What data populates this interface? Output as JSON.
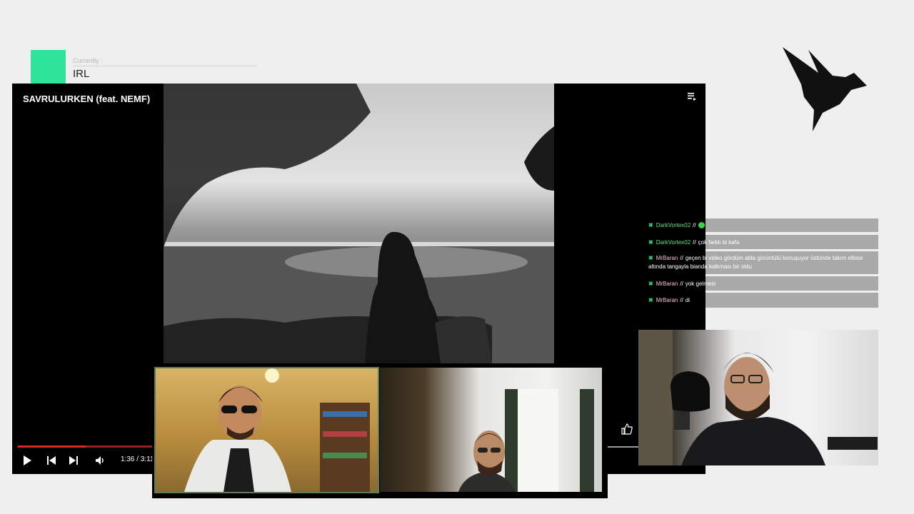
{
  "header": {
    "currently_label": "Currently :",
    "currently_value": "IRL"
  },
  "player": {
    "title": "SAVRULURKEN (feat. NEMF)",
    "time": "1:36 / 3:11",
    "progress": 0.5,
    "icons": [
      "playlist-icon",
      "play-icon",
      "previous-icon",
      "next-icon",
      "volume-icon",
      "like-icon"
    ]
  },
  "chat": {
    "messages": [
      {
        "badge": "✖",
        "user": "DarkVortex02",
        "sep": "//",
        "text": ""
      },
      {
        "badge": "✖",
        "user": "DarkVortex02",
        "sep": "//",
        "text": "çok farklı bi kafa"
      },
      {
        "badge": "✖",
        "user": "MrBaran",
        "sep": "//",
        "text": "geçen bi video gördüm abla görüntülü konuşuyor üstünde takım elbise altında tangayla bianda kalkması bir oldu"
      },
      {
        "badge": "✖",
        "user": "MrBaran",
        "sep": "//",
        "text": "yok gelmesi"
      },
      {
        "badge": "✖",
        "user": "MrBaran",
        "sep": "//",
        "text": "di"
      }
    ]
  },
  "colors": {
    "accent": "#2ee39a",
    "background": "#efefef",
    "progress": "#e52222",
    "chat_bar": "#a9a9a9"
  },
  "logo": "bird-logo"
}
